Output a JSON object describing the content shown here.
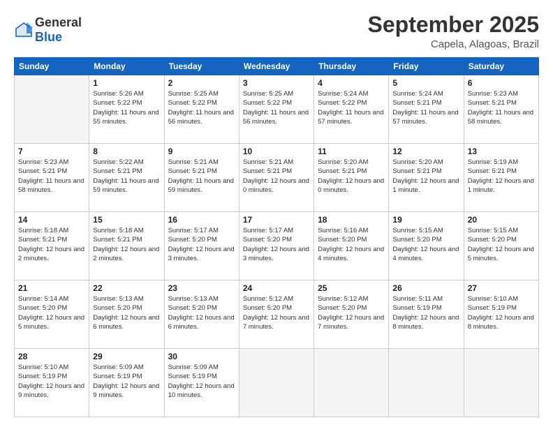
{
  "logo": {
    "general": "General",
    "blue": "Blue"
  },
  "title": "September 2025",
  "subtitle": "Capela, Alagoas, Brazil",
  "days": [
    "Sunday",
    "Monday",
    "Tuesday",
    "Wednesday",
    "Thursday",
    "Friday",
    "Saturday"
  ],
  "weeks": [
    [
      {
        "date": "",
        "sunrise": "",
        "sunset": "",
        "daylight": ""
      },
      {
        "date": "1",
        "sunrise": "Sunrise: 5:26 AM",
        "sunset": "Sunset: 5:22 PM",
        "daylight": "Daylight: 11 hours and 55 minutes."
      },
      {
        "date": "2",
        "sunrise": "Sunrise: 5:25 AM",
        "sunset": "Sunset: 5:22 PM",
        "daylight": "Daylight: 11 hours and 56 minutes."
      },
      {
        "date": "3",
        "sunrise": "Sunrise: 5:25 AM",
        "sunset": "Sunset: 5:22 PM",
        "daylight": "Daylight: 11 hours and 56 minutes."
      },
      {
        "date": "4",
        "sunrise": "Sunrise: 5:24 AM",
        "sunset": "Sunset: 5:22 PM",
        "daylight": "Daylight: 11 hours and 57 minutes."
      },
      {
        "date": "5",
        "sunrise": "Sunrise: 5:24 AM",
        "sunset": "Sunset: 5:21 PM",
        "daylight": "Daylight: 11 hours and 57 minutes."
      },
      {
        "date": "6",
        "sunrise": "Sunrise: 5:23 AM",
        "sunset": "Sunset: 5:21 PM",
        "daylight": "Daylight: 11 hours and 58 minutes."
      }
    ],
    [
      {
        "date": "7",
        "sunrise": "Sunrise: 5:23 AM",
        "sunset": "Sunset: 5:21 PM",
        "daylight": "Daylight: 11 hours and 58 minutes."
      },
      {
        "date": "8",
        "sunrise": "Sunrise: 5:22 AM",
        "sunset": "Sunset: 5:21 PM",
        "daylight": "Daylight: 11 hours and 59 minutes."
      },
      {
        "date": "9",
        "sunrise": "Sunrise: 5:21 AM",
        "sunset": "Sunset: 5:21 PM",
        "daylight": "Daylight: 11 hours and 59 minutes."
      },
      {
        "date": "10",
        "sunrise": "Sunrise: 5:21 AM",
        "sunset": "Sunset: 5:21 PM",
        "daylight": "Daylight: 12 hours and 0 minutes."
      },
      {
        "date": "11",
        "sunrise": "Sunrise: 5:20 AM",
        "sunset": "Sunset: 5:21 PM",
        "daylight": "Daylight: 12 hours and 0 minutes."
      },
      {
        "date": "12",
        "sunrise": "Sunrise: 5:20 AM",
        "sunset": "Sunset: 5:21 PM",
        "daylight": "Daylight: 12 hours and 1 minute."
      },
      {
        "date": "13",
        "sunrise": "Sunrise: 5:19 AM",
        "sunset": "Sunset: 5:21 PM",
        "daylight": "Daylight: 12 hours and 1 minute."
      }
    ],
    [
      {
        "date": "14",
        "sunrise": "Sunrise: 5:18 AM",
        "sunset": "Sunset: 5:21 PM",
        "daylight": "Daylight: 12 hours and 2 minutes."
      },
      {
        "date": "15",
        "sunrise": "Sunrise: 5:18 AM",
        "sunset": "Sunset: 5:21 PM",
        "daylight": "Daylight: 12 hours and 2 minutes."
      },
      {
        "date": "16",
        "sunrise": "Sunrise: 5:17 AM",
        "sunset": "Sunset: 5:20 PM",
        "daylight": "Daylight: 12 hours and 3 minutes."
      },
      {
        "date": "17",
        "sunrise": "Sunrise: 5:17 AM",
        "sunset": "Sunset: 5:20 PM",
        "daylight": "Daylight: 12 hours and 3 minutes."
      },
      {
        "date": "18",
        "sunrise": "Sunrise: 5:16 AM",
        "sunset": "Sunset: 5:20 PM",
        "daylight": "Daylight: 12 hours and 4 minutes."
      },
      {
        "date": "19",
        "sunrise": "Sunrise: 5:15 AM",
        "sunset": "Sunset: 5:20 PM",
        "daylight": "Daylight: 12 hours and 4 minutes."
      },
      {
        "date": "20",
        "sunrise": "Sunrise: 5:15 AM",
        "sunset": "Sunset: 5:20 PM",
        "daylight": "Daylight: 12 hours and 5 minutes."
      }
    ],
    [
      {
        "date": "21",
        "sunrise": "Sunrise: 5:14 AM",
        "sunset": "Sunset: 5:20 PM",
        "daylight": "Daylight: 12 hours and 5 minutes."
      },
      {
        "date": "22",
        "sunrise": "Sunrise: 5:13 AM",
        "sunset": "Sunset: 5:20 PM",
        "daylight": "Daylight: 12 hours and 6 minutes."
      },
      {
        "date": "23",
        "sunrise": "Sunrise: 5:13 AM",
        "sunset": "Sunset: 5:20 PM",
        "daylight": "Daylight: 12 hours and 6 minutes."
      },
      {
        "date": "24",
        "sunrise": "Sunrise: 5:12 AM",
        "sunset": "Sunset: 5:20 PM",
        "daylight": "Daylight: 12 hours and 7 minutes."
      },
      {
        "date": "25",
        "sunrise": "Sunrise: 5:12 AM",
        "sunset": "Sunset: 5:20 PM",
        "daylight": "Daylight: 12 hours and 7 minutes."
      },
      {
        "date": "26",
        "sunrise": "Sunrise: 5:11 AM",
        "sunset": "Sunset: 5:19 PM",
        "daylight": "Daylight: 12 hours and 8 minutes."
      },
      {
        "date": "27",
        "sunrise": "Sunrise: 5:10 AM",
        "sunset": "Sunset: 5:19 PM",
        "daylight": "Daylight: 12 hours and 8 minutes."
      }
    ],
    [
      {
        "date": "28",
        "sunrise": "Sunrise: 5:10 AM",
        "sunset": "Sunset: 5:19 PM",
        "daylight": "Daylight: 12 hours and 9 minutes."
      },
      {
        "date": "29",
        "sunrise": "Sunrise: 5:09 AM",
        "sunset": "Sunset: 5:19 PM",
        "daylight": "Daylight: 12 hours and 9 minutes."
      },
      {
        "date": "30",
        "sunrise": "Sunrise: 5:09 AM",
        "sunset": "Sunset: 5:19 PM",
        "daylight": "Daylight: 12 hours and 10 minutes."
      },
      {
        "date": "",
        "sunrise": "",
        "sunset": "",
        "daylight": ""
      },
      {
        "date": "",
        "sunrise": "",
        "sunset": "",
        "daylight": ""
      },
      {
        "date": "",
        "sunrise": "",
        "sunset": "",
        "daylight": ""
      },
      {
        "date": "",
        "sunrise": "",
        "sunset": "",
        "daylight": ""
      }
    ]
  ]
}
